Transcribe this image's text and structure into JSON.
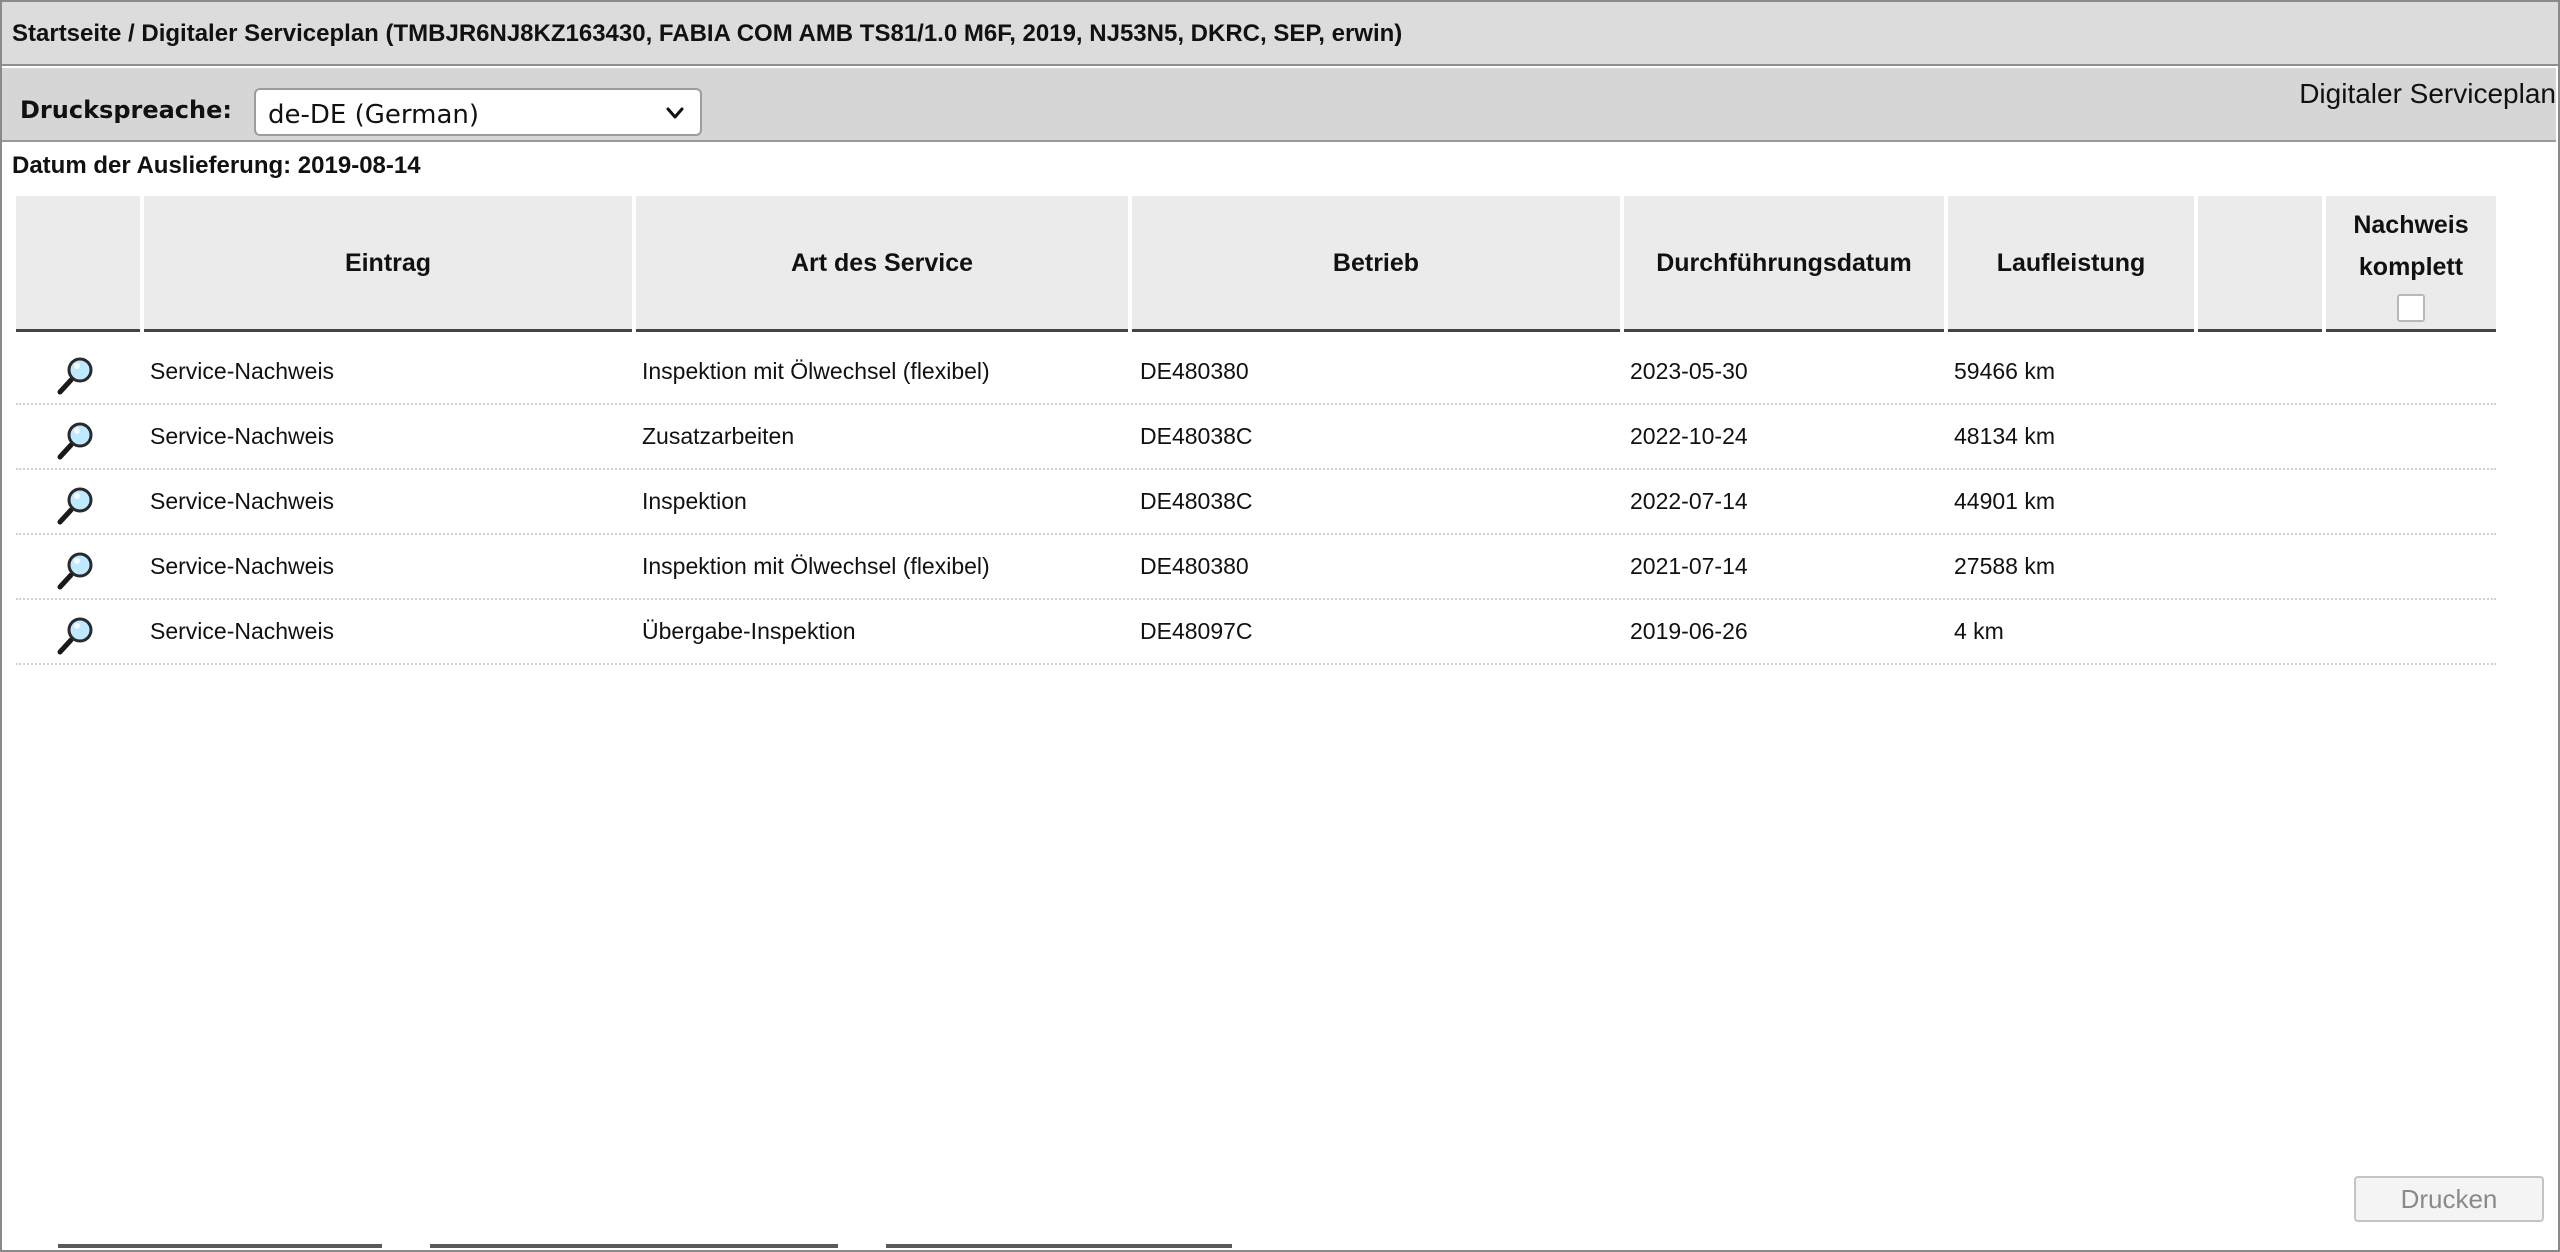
{
  "breadcrumb": "Startseite / Digitaler Serviceplan (TMBJR6NJ8KZ163430, FABIA COM AMB TS81/1.0 M6F, 2019, NJ53N5, DKRC, SEP, erwin)",
  "toolbar": {
    "print_language_label": "Druckspreache:",
    "print_language_value": "de-DE (German)"
  },
  "page_title": "Digitaler Serviceplan",
  "delivery_date": "Datum der Auslieferung: 2019-08-14",
  "table": {
    "headers": {
      "entry": "Eintrag",
      "service_type": "Art des Service",
      "workshop": "Betrieb",
      "date": "Durchführungsdatum",
      "mileage": "Laufleistung",
      "proof_line1": "Nachweis",
      "proof_line2": "komplett"
    },
    "rows": [
      {
        "entry": "Service-Nachweis",
        "service_type": "Inspektion mit Ölwechsel (flexibel)",
        "workshop": "DE480380",
        "date": "2023-05-30",
        "mileage": "59466 km"
      },
      {
        "entry": "Service-Nachweis",
        "service_type": "Zusatzarbeiten",
        "workshop": "DE48038C",
        "date": "2022-10-24",
        "mileage": "48134 km"
      },
      {
        "entry": "Service-Nachweis",
        "service_type": "Inspektion",
        "workshop": "DE48038C",
        "date": "2022-07-14",
        "mileage": "44901 km"
      },
      {
        "entry": "Service-Nachweis",
        "service_type": "Inspektion mit Ölwechsel (flexibel)",
        "workshop": "DE480380",
        "date": "2021-07-14",
        "mileage": "27588 km"
      },
      {
        "entry": "Service-Nachweis",
        "service_type": "Übergabe-Inspektion",
        "workshop": "DE48097C",
        "date": "2019-06-26",
        "mileage": "4 km"
      }
    ]
  },
  "print_button": "Drucken",
  "icons": {
    "row_action": "magnifier-icon",
    "dropdown": "chevron-down-icon"
  },
  "colors": {
    "magnifier_lens": "#bfe9ff",
    "header_bg": "#ebebeb",
    "toolbar_bg": "#d6d6d6"
  }
}
